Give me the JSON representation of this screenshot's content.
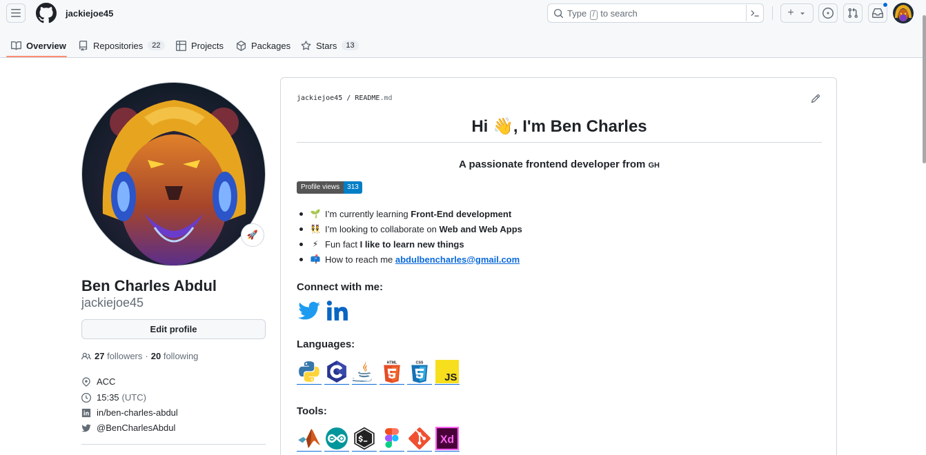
{
  "header": {
    "username": "jackiejoe45",
    "search_placeholder_before": "Type",
    "search_key": "/",
    "search_placeholder_after": "to search"
  },
  "tabs": [
    {
      "label": "Overview"
    },
    {
      "label": "Repositories",
      "count": "22"
    },
    {
      "label": "Projects"
    },
    {
      "label": "Packages"
    },
    {
      "label": "Stars",
      "count": "13"
    }
  ],
  "profile": {
    "full_name": "Ben Charles Abdul",
    "login": "jackiejoe45",
    "edit_label": "Edit profile",
    "followers_count": "27",
    "followers_label": "followers",
    "separator": "·",
    "following_count": "20",
    "following_label": "following",
    "location": "ACC",
    "local_time": "15:35",
    "timezone": "(UTC)",
    "linkedin": "in/ben-charles-abdul",
    "twitter": "@BenCharlesAbdul",
    "status_emoji": "🚀"
  },
  "readme": {
    "path_user": "jackiejoe45",
    "path_sep": "/",
    "path_file": "README",
    "path_ext": ".md",
    "title": "Hi 👋, I'm Ben Charles",
    "subtitle": "A passionate frontend developer from",
    "subtitle_suffix": "GH",
    "badge_label": "Profile views",
    "badge_value": "313",
    "bullets": [
      {
        "emoji": "🌱",
        "text": "I’m currently learning",
        "bold": "Front-End development"
      },
      {
        "emoji": "👯",
        "text": "I’m looking to collaborate on",
        "bold": "Web and Web Apps"
      },
      {
        "emoji": "⚡",
        "text": "Fun fact",
        "bold": "I like to learn new things"
      },
      {
        "emoji": "📫",
        "text": "How to reach me",
        "link": "abdulbencharles@gmail.com"
      }
    ],
    "connect_heading": "Connect with me:",
    "languages_heading": "Languages:",
    "tools_heading": "Tools:",
    "social_icons": [
      "twitter-icon",
      "linkedin-icon"
    ],
    "language_icons": [
      "python-icon",
      "c-icon",
      "java-icon",
      "html5-icon",
      "css3-icon",
      "javascript-icon"
    ],
    "tool_icons": [
      "matlab-icon",
      "arduino-icon",
      "bash-icon",
      "figma-icon",
      "git-icon",
      "xd-icon"
    ],
    "html_label": "HTML",
    "css_label": "CSS",
    "js_label": "JS",
    "xd_label": "Xd"
  },
  "colors": {
    "accent": "#0969da",
    "tab_underline": "#fd8c73",
    "badge_left": "#555555",
    "badge_right": "#007ec6"
  }
}
